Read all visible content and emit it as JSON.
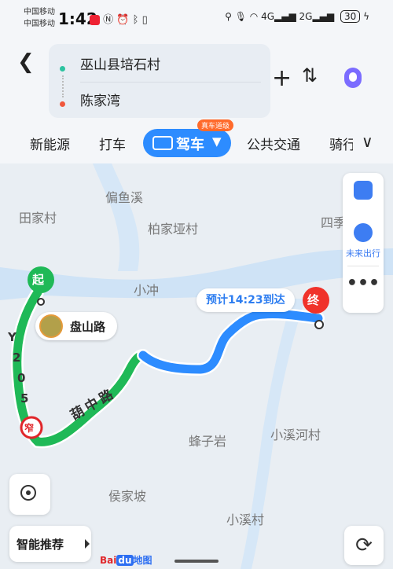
{
  "status": {
    "carrier1": "中国移动",
    "carrier2": "中国移动",
    "time": "1:42",
    "net1": "4G",
    "net2": "2G",
    "battery": "30"
  },
  "route": {
    "origin": "巫山县培石村",
    "destination": "陈家湾"
  },
  "modes": {
    "new_energy": "新能源",
    "taxi": "打车",
    "drive": "驾车",
    "drive_badge": "真车道级",
    "transit": "公共交通",
    "cycle": "骑行"
  },
  "map": {
    "labels": [
      "偏鱼溪",
      "田家村",
      "柏家垭村",
      "四季",
      "小冲",
      "蜂子岩",
      "小溪河村",
      "侯家坡",
      "小溪村"
    ],
    "road_y205": [
      "Y",
      "2",
      "0",
      "5"
    ],
    "road_huzhong": "葫中路",
    "start_marker": "起",
    "end_marker": "终",
    "narrow_marker": "窄",
    "eta": "预计14:23到达",
    "panshan_label": "盘山路"
  },
  "sidepanel": {
    "future_trip": "未来出行",
    "more": "•••"
  },
  "bottom": {
    "smart_recommend": "智能推荐",
    "logo_bai": "Bai",
    "logo_du": "du",
    "logo_map": "地图"
  },
  "colors": {
    "route_blue": "#2d8cff",
    "route_green": "#1fb957",
    "water": "#cfe3f6",
    "land": "#e9eef3"
  }
}
